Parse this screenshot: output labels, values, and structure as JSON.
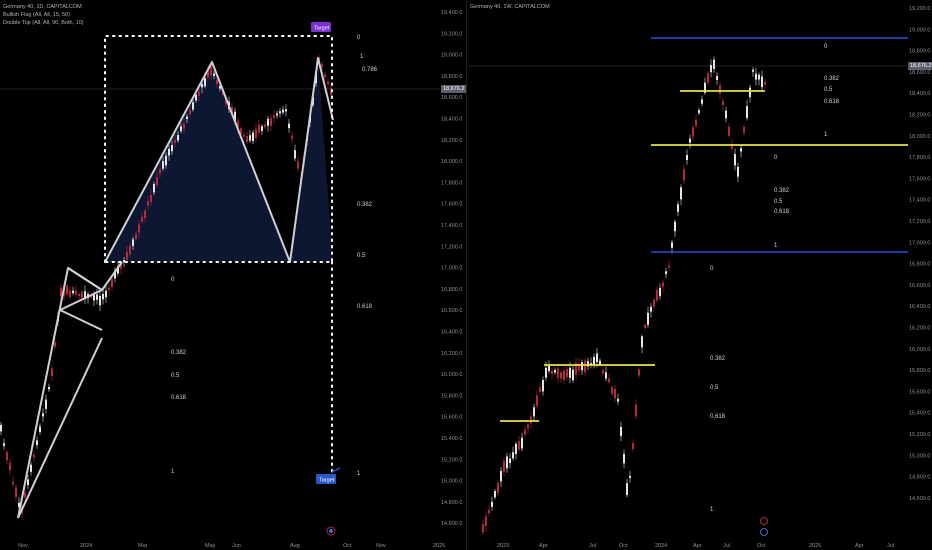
{
  "left": {
    "legend": [
      "Germany 40, 1D, CAPITALCOM",
      "Bullish Flag (All, All, 15, 50)",
      "Double Top (All, All, 90, Both, 10)"
    ],
    "price_axis": [
      "19,400.0",
      "19,200.0",
      "19,000.0",
      "18,800.0",
      "18,600.0",
      "18,400.0",
      "18,200.0",
      "18,000.0",
      "17,800.0",
      "17,600.0",
      "17,400.0",
      "17,200.0",
      "17,000.0",
      "16,800.0",
      "16,600.0",
      "16,400.0",
      "16,200.0",
      "16,000.0",
      "15,800.0",
      "15,600.0",
      "15,400.0",
      "15,200.0",
      "15,000.0",
      "14,800.0",
      "14,600.0"
    ],
    "price_tag": "18,676.2",
    "time_axis": [
      "Nov",
      "2024",
      "Mar",
      "May",
      "Jun",
      "Aug",
      "Oct",
      "Nov",
      "2025"
    ],
    "target_top": "Target",
    "target_bottom": "Target",
    "fibs_upper": [
      "0",
      "1",
      "0.786",
      "0.382",
      "0.5",
      "0.618"
    ],
    "fibs_lower": [
      "0",
      "0.382",
      "0.5",
      "0.618",
      "1",
      "1"
    ],
    "colors": {
      "target_top": "#7b2fd1",
      "target_bottom": "#2b57c9",
      "fill": "#0f1a36"
    }
  },
  "right": {
    "legend": [
      "Germany 40, 1W, CAPITALCOM"
    ],
    "price_axis": [
      "19,200.0",
      "19,000.0",
      "18,800.0",
      "18,600.0",
      "18,400.0",
      "18,200.0",
      "18,000.0",
      "17,800.0",
      "17,600.0",
      "17,400.0",
      "17,200.0",
      "17,000.0",
      "16,800.0",
      "16,600.0",
      "16,400.0",
      "16,200.0",
      "16,000.0",
      "15,800.0",
      "15,600.0",
      "15,400.0",
      "15,200.0",
      "15,000.0",
      "14,800.0",
      "14,600.0"
    ],
    "price_tag": "18,676.2",
    "time_axis": [
      "2023",
      "Apr",
      "Jul",
      "Oct",
      "2024",
      "Apr",
      "Jul",
      "Oct",
      "2025",
      "Apr",
      "Jul"
    ],
    "fibs_a": [
      "0",
      "0.382",
      "0.5",
      "0.618",
      "1"
    ],
    "fibs_b": [
      "0",
      "0.382",
      "0.5",
      "0.618",
      "1"
    ],
    "fibs_c": [
      "0",
      "0.382",
      "0.5",
      "0.618",
      "1"
    ],
    "colors": {
      "blue_line": "#2d4fd6",
      "yellow_line": "#e8e24a"
    }
  }
}
